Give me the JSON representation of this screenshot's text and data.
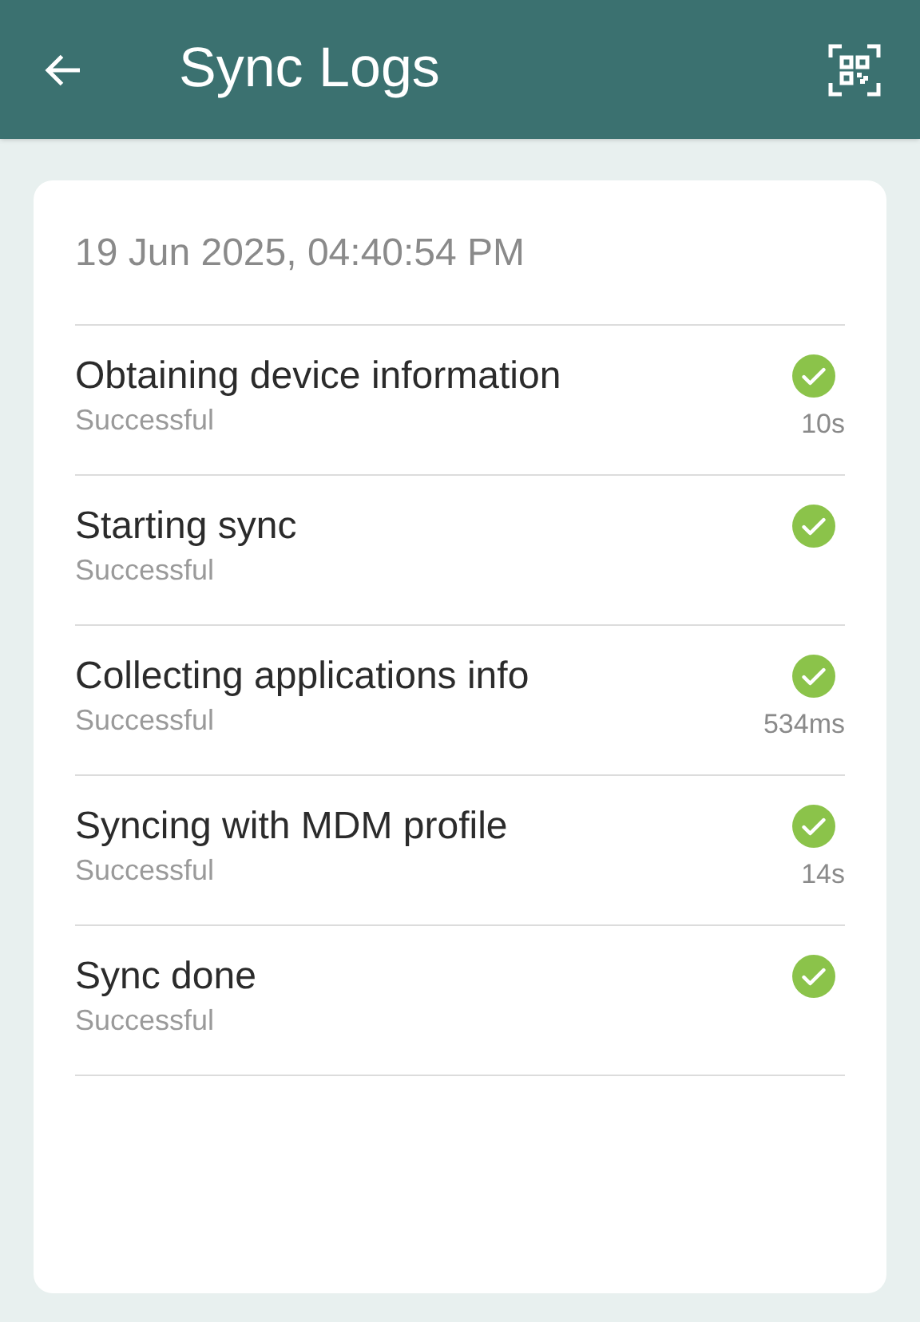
{
  "app_bar": {
    "title": "Sync Logs"
  },
  "log": {
    "timestamp": "19 Jun 2025, 04:40:54 PM",
    "steps": [
      {
        "title": "Obtaining device information",
        "status": "Successful",
        "kind": "success",
        "duration": "10s"
      },
      {
        "title": "Starting sync",
        "status": "Successful",
        "kind": "success"
      },
      {
        "title": "Collecting applications info",
        "status": "Successful",
        "kind": "success",
        "duration": "534ms"
      },
      {
        "title": "Syncing with MDM profile",
        "status": "Successful",
        "kind": "success",
        "duration": "14s"
      },
      {
        "title": "Sync done",
        "status": "Successful",
        "kind": "success"
      }
    ]
  }
}
